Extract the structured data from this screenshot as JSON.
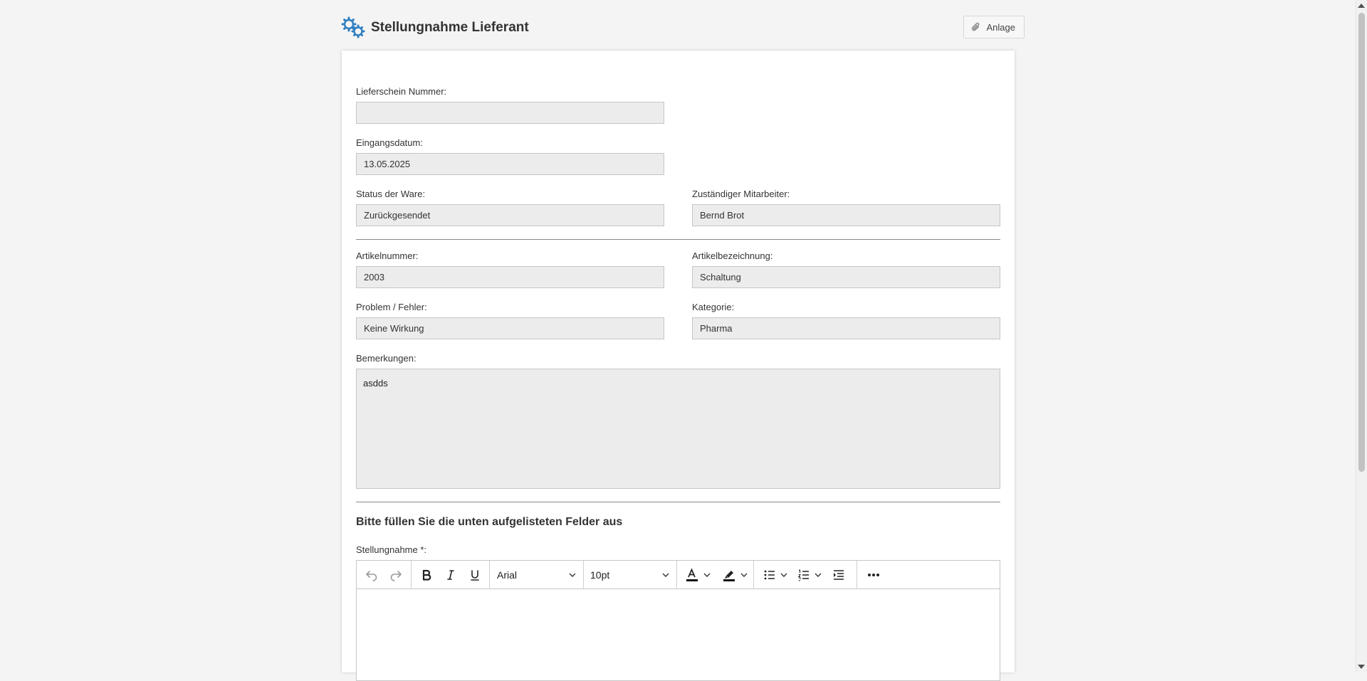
{
  "header": {
    "title": "Stellungnahme Lieferant",
    "attach_label": "Anlage"
  },
  "form": {
    "lieferschein": {
      "label": "Lieferschein Nummer:",
      "value": ""
    },
    "eingangsdatum": {
      "label": "Eingangsdatum:",
      "value": "13.05.2025"
    },
    "status": {
      "label": "Status der Ware:",
      "value": "Zurückgesendet"
    },
    "mitarbeiter": {
      "label": "Zuständiger Mitarbeiter:",
      "value": "Bernd Brot"
    },
    "artikelnummer": {
      "label": "Artikelnummer:",
      "value": "2003"
    },
    "artikelbezeichnung": {
      "label": "Artikelbezeichnung:",
      "value": "Schaltung"
    },
    "problem": {
      "label": "Problem / Fehler:",
      "value": "Keine Wirkung"
    },
    "kategorie": {
      "label": "Kategorie:",
      "value": "Pharma"
    },
    "bemerkungen": {
      "label": "Bemerkungen:",
      "value": "asdds"
    }
  },
  "section": {
    "title": "Bitte füllen Sie die unten aufgelisteten Felder aus"
  },
  "editor": {
    "label": "Stellungnahme *:",
    "font": "Arial",
    "size": "10pt",
    "icons": [
      "undo-icon",
      "redo-icon",
      "bold-icon",
      "italic-icon",
      "underline-icon",
      "text-color-icon",
      "highlight-icon",
      "bullet-list-icon",
      "numbered-list-icon",
      "indent-icon",
      "more-icon"
    ]
  },
  "colors": {
    "accent": "#2f7fc1",
    "field_bg": "#ececec",
    "page_bg": "#f4f4f4"
  }
}
